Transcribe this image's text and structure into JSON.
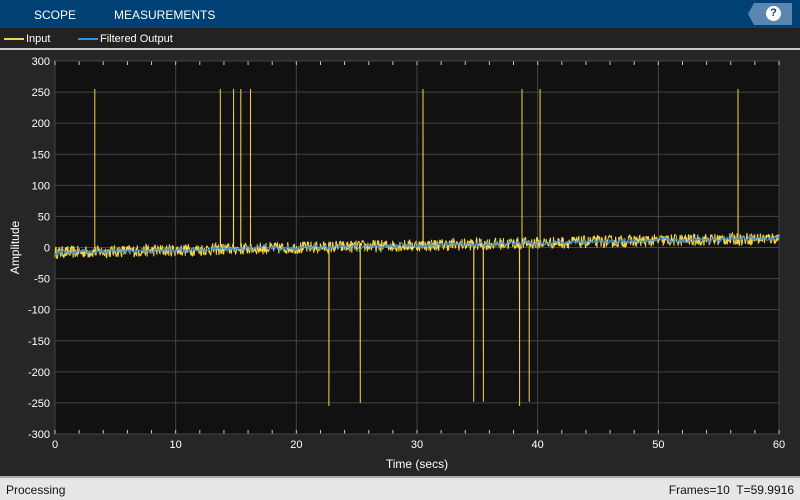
{
  "toolbar": {
    "tabs": [
      "SCOPE",
      "MEASUREMENTS"
    ],
    "help_icon": "?"
  },
  "legend": [
    {
      "name": "Input",
      "color": "#f2d44e"
    },
    {
      "name": "Filtered Output",
      "color": "#3a8fd8"
    }
  ],
  "status": {
    "left": "Processing",
    "right": "Frames=10  T=59.9916"
  },
  "chart_data": {
    "type": "line",
    "xlabel": "Time (secs)",
    "ylabel": "Amplitude",
    "xlim": [
      0,
      60
    ],
    "ylim": [
      -300,
      300
    ],
    "xticks": [
      0,
      10,
      20,
      30,
      40,
      50,
      60
    ],
    "yticks": [
      -300,
      -250,
      -200,
      -150,
      -100,
      -50,
      0,
      50,
      100,
      150,
      200,
      250,
      300
    ],
    "grid": true,
    "series": [
      {
        "name": "Input",
        "color": "#f2d44e",
        "noise_amplitude": 10,
        "trend": [
          -8,
          15
        ],
        "spikes": [
          [
            3.3,
            255
          ],
          [
            13.7,
            255
          ],
          [
            14.8,
            255
          ],
          [
            15.4,
            255
          ],
          [
            16.2,
            255
          ],
          [
            22.7,
            -255
          ],
          [
            25.3,
            -250
          ],
          [
            30.5,
            255
          ],
          [
            34.7,
            -248
          ],
          [
            35.5,
            -248
          ],
          [
            38.5,
            -255
          ],
          [
            38.7,
            255
          ],
          [
            39.3,
            -248
          ],
          [
            40.2,
            255
          ],
          [
            56.6,
            255
          ]
        ]
      },
      {
        "name": "Filtered Output",
        "color": "#3a8fd8",
        "noise_amplitude": 4,
        "trend": [
          -8,
          15
        ]
      }
    ]
  }
}
